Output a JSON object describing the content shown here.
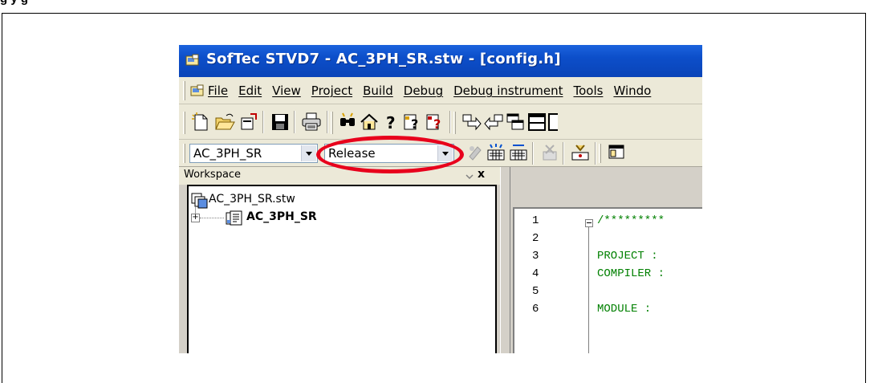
{
  "heading": "g                                      y g",
  "window": {
    "title": "SofTec STVD7 - AC_3PH_SR.stw - [config.h]"
  },
  "menu": {
    "items": [
      "File",
      "Edit",
      "View",
      "Project",
      "Build",
      "Debug",
      "Debug instrument",
      "Tools",
      "Windo"
    ]
  },
  "toolbar1": {
    "buttons": [
      "new-file-icon",
      "open-folder-icon",
      "open-workspace-icon",
      "save-icon",
      "print-icon",
      "find-in-files-icon",
      "home-icon",
      "help-icon",
      "context-help-icon",
      "help-topics-icon",
      "step-into-icon",
      "step-out-icon",
      "windows-icon",
      "horizontal-split-icon"
    ]
  },
  "toolbar2": {
    "project_combo": "AC_3PH_SR",
    "config_combo": "Release",
    "buttons": [
      "compile-icon",
      "build-icon",
      "rebuild-all-icon",
      "stop-build-icon",
      "debug-icon",
      "window-icon"
    ]
  },
  "workspace": {
    "title": "Workspace",
    "close_glyph": "x",
    "expand_glyph": "+",
    "tree": {
      "root": "AC_3PH_SR.stw",
      "project": "AC_3PH_SR"
    }
  },
  "editor": {
    "lines": [
      {
        "num": "1",
        "code": "/*********"
      },
      {
        "num": "2",
        "code": ""
      },
      {
        "num": "3",
        "code": "PROJECT  :"
      },
      {
        "num": "4",
        "code": "COMPILER :"
      },
      {
        "num": "5",
        "code": ""
      },
      {
        "num": "6",
        "code": "MODULE  :"
      }
    ]
  },
  "colors": {
    "titlebar": "#0c4ec9",
    "highlight": "#e8001c",
    "comment": "#008000"
  }
}
